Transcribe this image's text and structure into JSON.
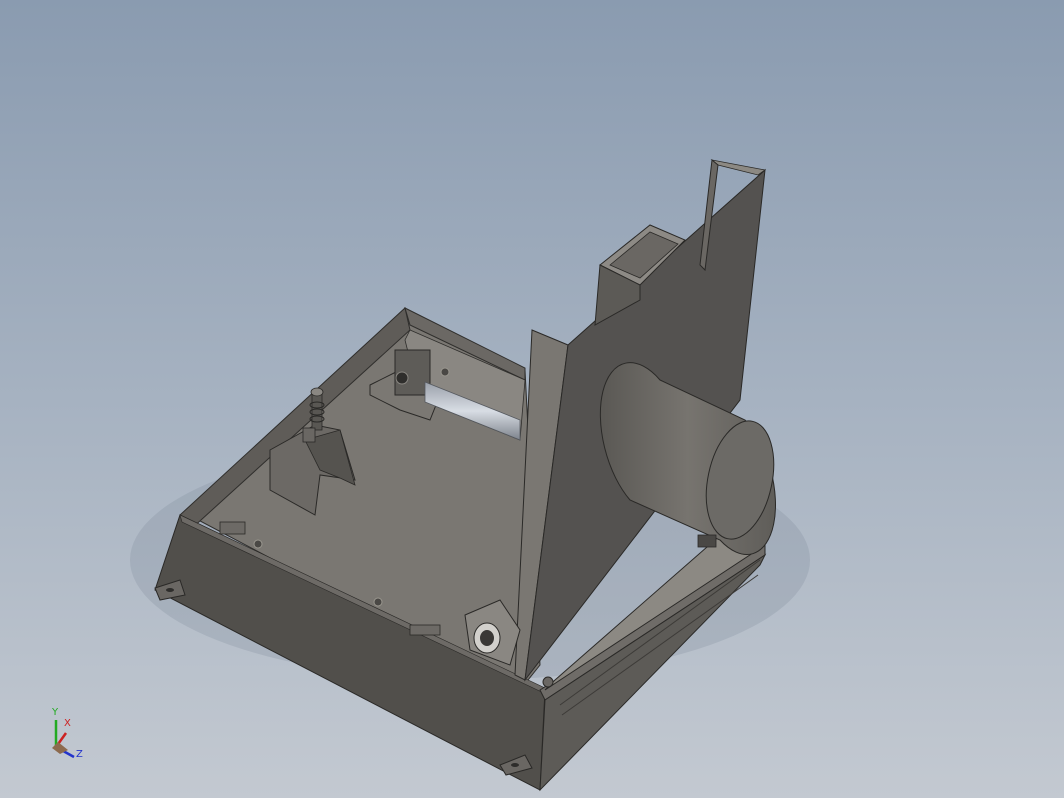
{
  "triad": {
    "x_label": "X",
    "y_label": "Y",
    "z_label": "Z",
    "x_color": "#cc2222",
    "y_color": "#22aa22",
    "z_color": "#2233cc"
  },
  "model": {
    "icon": "cad-assembly-icon"
  }
}
